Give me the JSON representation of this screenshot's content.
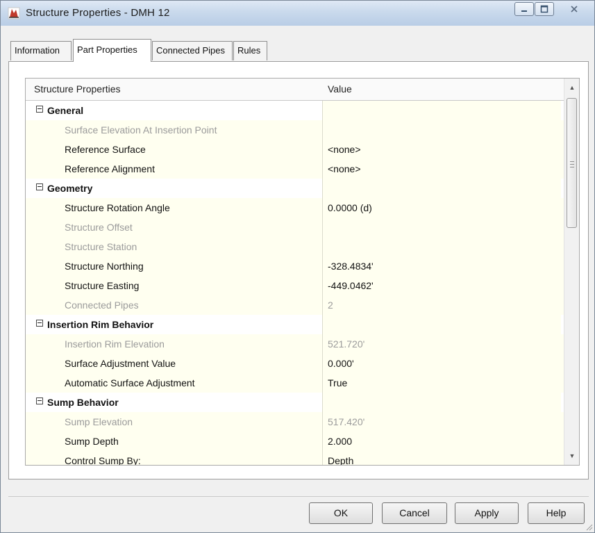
{
  "window": {
    "title": "Structure Properties - DMH 12"
  },
  "tabs": [
    "Information",
    "Part Properties",
    "Connected Pipes",
    "Rules"
  ],
  "grid": {
    "col_property": "Structure Properties",
    "col_value": "Value",
    "rows": [
      {
        "type": "category",
        "label": "General",
        "value": ""
      },
      {
        "type": "property",
        "label": "Surface Elevation At Insertion Point",
        "value": "",
        "enabled": false
      },
      {
        "type": "property",
        "label": "Reference Surface",
        "value": "<none>",
        "enabled": true
      },
      {
        "type": "property",
        "label": "Reference Alignment",
        "value": "<none>",
        "enabled": true
      },
      {
        "type": "category",
        "label": "Geometry",
        "value": ""
      },
      {
        "type": "property",
        "label": "Structure Rotation Angle",
        "value": "0.0000 (d)",
        "enabled": true
      },
      {
        "type": "property",
        "label": "Structure Offset",
        "value": "",
        "enabled": false
      },
      {
        "type": "property",
        "label": "Structure Station",
        "value": "",
        "enabled": false
      },
      {
        "type": "property",
        "label": "Structure Northing",
        "value": "-328.4834'",
        "enabled": true
      },
      {
        "type": "property",
        "label": "Structure Easting",
        "value": "-449.0462'",
        "enabled": true
      },
      {
        "type": "property",
        "label": "Connected Pipes",
        "value": "2",
        "enabled": false
      },
      {
        "type": "category",
        "label": "Insertion Rim Behavior",
        "value": ""
      },
      {
        "type": "property",
        "label": "Insertion Rim Elevation",
        "value": "521.720'",
        "enabled": false
      },
      {
        "type": "property",
        "label": "Surface Adjustment Value",
        "value": "0.000'",
        "enabled": true
      },
      {
        "type": "property",
        "label": "Automatic Surface Adjustment",
        "value": "True",
        "enabled": true
      },
      {
        "type": "category",
        "label": "Sump Behavior",
        "value": ""
      },
      {
        "type": "property",
        "label": "Sump Elevation",
        "value": "517.420'",
        "enabled": false
      },
      {
        "type": "property",
        "label": "Sump Depth",
        "value": "2.000",
        "enabled": true
      },
      {
        "type": "property",
        "label": "Control Sump By:",
        "value": "Depth",
        "enabled": true
      }
    ]
  },
  "buttons": {
    "ok": "OK",
    "cancel": "Cancel",
    "apply": "Apply",
    "help": "Help"
  }
}
